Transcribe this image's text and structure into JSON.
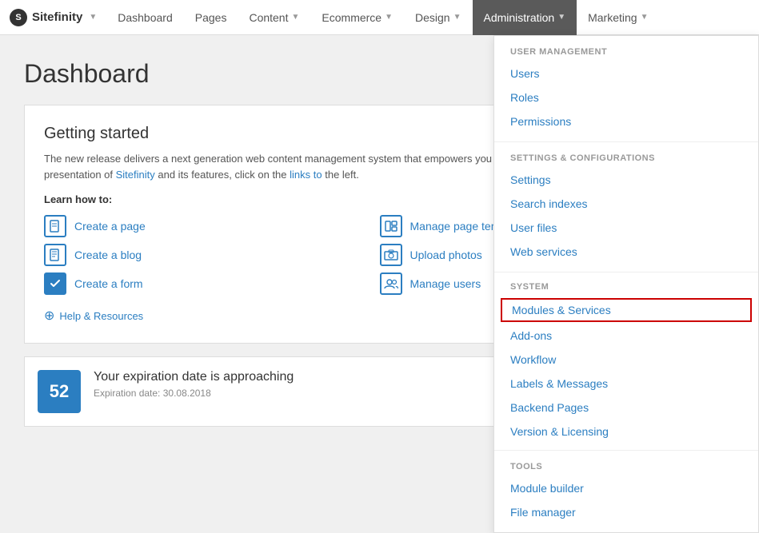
{
  "brand": {
    "name": "Sitefinity",
    "logo_char": "S"
  },
  "topnav": {
    "items": [
      {
        "id": "dashboard",
        "label": "Dashboard",
        "has_chevron": false,
        "active": false
      },
      {
        "id": "pages",
        "label": "Pages",
        "has_chevron": false,
        "active": false
      },
      {
        "id": "content",
        "label": "Content",
        "has_chevron": true,
        "active": false
      },
      {
        "id": "ecommerce",
        "label": "Ecommerce",
        "has_chevron": true,
        "active": false
      },
      {
        "id": "design",
        "label": "Design",
        "has_chevron": true,
        "active": false
      },
      {
        "id": "administration",
        "label": "Administration",
        "has_chevron": true,
        "active": true
      },
      {
        "id": "marketing",
        "label": "Marketing",
        "has_chevron": true,
        "active": false
      }
    ]
  },
  "page_title": "Dashboard",
  "getting_started": {
    "title": "Getting started",
    "description": "The new release delivers a next generation web content management system that empowers you to create compelling websites. For general presentation of Sitefinity and its features, click on the links to the left.",
    "learn_label": "Learn how to:",
    "shortcuts": [
      {
        "id": "create-page",
        "label": "Create a page",
        "icon": "page"
      },
      {
        "id": "manage-templates",
        "label": "Manage page templates",
        "icon": "template"
      },
      {
        "id": "create-blog",
        "label": "Create a blog",
        "icon": "blog"
      },
      {
        "id": "upload-photos",
        "label": "Upload photos",
        "icon": "photos"
      },
      {
        "id": "create-form",
        "label": "Create a form",
        "icon": "form"
      },
      {
        "id": "manage-users",
        "label": "Manage users",
        "icon": "users"
      }
    ],
    "help_link": "Help & Resources"
  },
  "expiration": {
    "icon_text": "52",
    "title": "Your expiration date is approaching",
    "subtitle": "Expiration date: 30.08.2018"
  },
  "dropdown": {
    "sections": [
      {
        "id": "user-management",
        "label": "USER MANAGEMENT",
        "items": [
          {
            "id": "users",
            "label": "Users"
          },
          {
            "id": "roles",
            "label": "Roles"
          },
          {
            "id": "permissions",
            "label": "Permissions"
          }
        ]
      },
      {
        "id": "settings-config",
        "label": "SETTINGS & CONFIGURATIONS",
        "items": [
          {
            "id": "settings",
            "label": "Settings"
          },
          {
            "id": "search-indexes",
            "label": "Search indexes"
          },
          {
            "id": "user-files",
            "label": "User files"
          },
          {
            "id": "web-services",
            "label": "Web services"
          }
        ]
      },
      {
        "id": "system",
        "label": "SYSTEM",
        "items": [
          {
            "id": "modules-services",
            "label": "Modules & Services",
            "highlighted": true
          },
          {
            "id": "add-ons",
            "label": "Add-ons"
          },
          {
            "id": "workflow",
            "label": "Workflow"
          },
          {
            "id": "labels-messages",
            "label": "Labels & Messages"
          },
          {
            "id": "backend-pages",
            "label": "Backend Pages"
          },
          {
            "id": "version-licensing",
            "label": "Version & Licensing"
          }
        ]
      },
      {
        "id": "tools",
        "label": "TOOLS",
        "items": [
          {
            "id": "module-builder",
            "label": "Module builder"
          },
          {
            "id": "file-manager",
            "label": "File manager"
          }
        ]
      }
    ]
  }
}
